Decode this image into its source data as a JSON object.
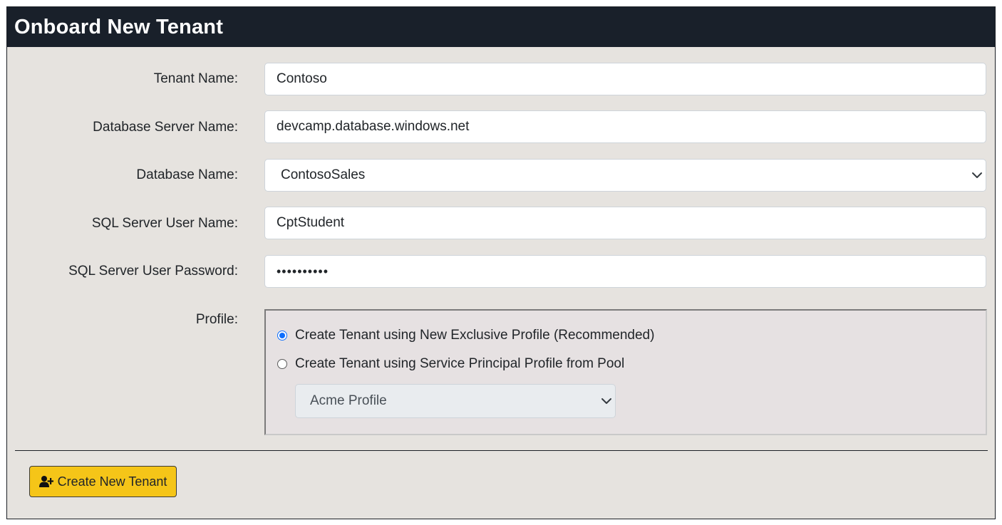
{
  "page": {
    "title": "Onboard New Tenant"
  },
  "form": {
    "tenant_name": {
      "label": "Tenant Name:",
      "value": "Contoso"
    },
    "db_server": {
      "label": "Database Server Name:",
      "value": "devcamp.database.windows.net"
    },
    "db_name": {
      "label": "Database Name:",
      "value": "ContosoSales"
    },
    "sql_user": {
      "label": "SQL Server User Name:",
      "value": "CptStudent"
    },
    "sql_password": {
      "label": "SQL Server User Password:",
      "value": "••••••••••"
    },
    "profile": {
      "label": "Profile:",
      "options": [
        {
          "label": "Create Tenant using New Exclusive Profile (Recommended)",
          "checked": true
        },
        {
          "label": "Create Tenant using Service Principal Profile from Pool",
          "checked": false
        }
      ],
      "pool_select": {
        "value": "Acme Profile",
        "disabled": true
      }
    }
  },
  "actions": {
    "create_label": "Create New Tenant",
    "create_icon": "user-plus-icon"
  },
  "colors": {
    "header_bg": "#19202a",
    "panel_bg": "#e6e3df",
    "button_bg": "#f5c518",
    "radio_accent": "#0d6efd"
  }
}
